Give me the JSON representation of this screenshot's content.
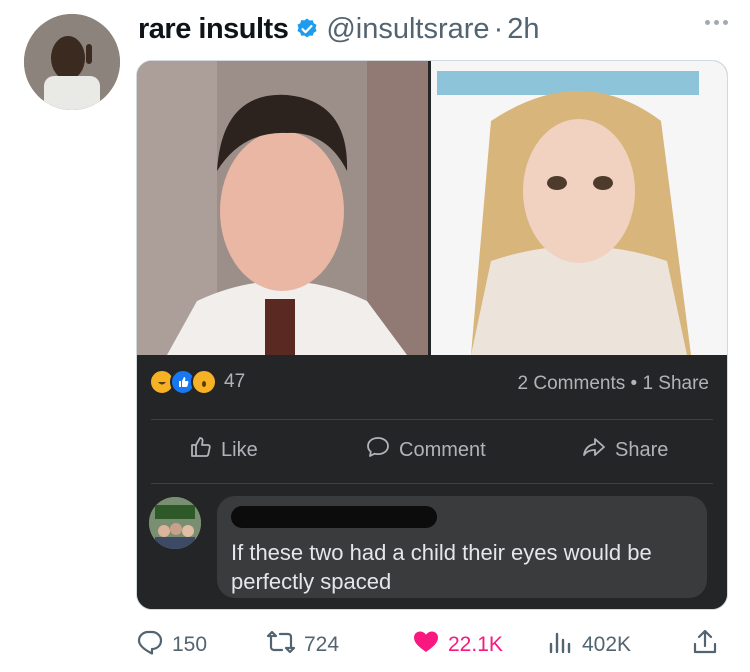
{
  "tweet": {
    "display_name": "rare insults",
    "handle": "@insultsrare",
    "separator": "·",
    "time": "2h",
    "verified": true
  },
  "embedded_post": {
    "reaction_count": "47",
    "stats": "2 Comments • 1 Share",
    "actions": [
      {
        "label": "Like",
        "icon": "thumbs-up-icon"
      },
      {
        "label": "Comment",
        "icon": "speech-bubble-icon"
      },
      {
        "label": "Share",
        "icon": "share-arrow-icon"
      }
    ],
    "comment_text": "If these two had a child their eyes would be perfectly spaced"
  },
  "engagement": {
    "replies": "150",
    "retweets": "724",
    "likes": "22.1K",
    "views": "402K"
  },
  "colors": {
    "verified_blue": "#1d9bf0",
    "like_pink": "#f91880",
    "fb_dark": "#242526",
    "fb_bubble": "#3a3b3c",
    "muted": "#536471"
  }
}
